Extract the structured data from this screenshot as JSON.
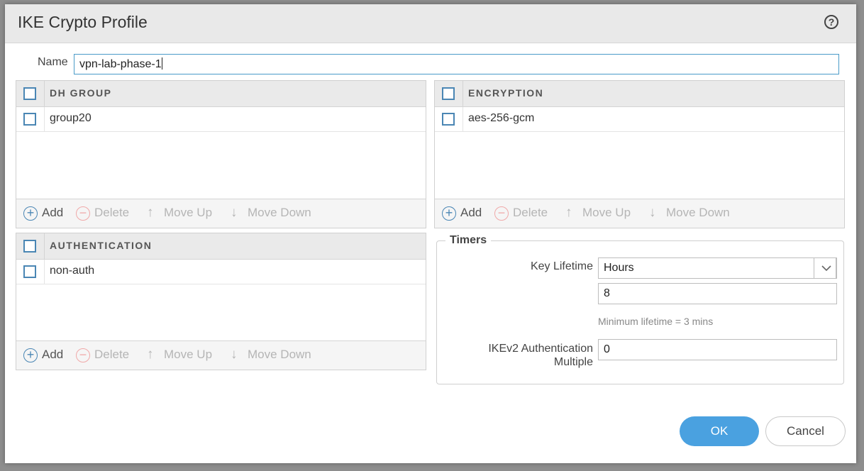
{
  "dialog": {
    "title": "IKE Crypto Profile",
    "help_icon": "help-icon"
  },
  "name": {
    "label": "Name",
    "value": "vpn-lab-phase-1"
  },
  "toolbar": {
    "add": "Add",
    "delete": "Delete",
    "move_up": "Move Up",
    "move_down": "Move Down"
  },
  "dh_group": {
    "header": "DH GROUP",
    "rows": [
      "group20"
    ]
  },
  "encryption": {
    "header": "ENCRYPTION",
    "rows": [
      "aes-256-gcm"
    ]
  },
  "authentication": {
    "header": "AUTHENTICATION",
    "rows": [
      "non-auth"
    ]
  },
  "timers": {
    "legend": "Timers",
    "key_lifetime_label": "Key Lifetime",
    "key_lifetime_unit": "Hours",
    "key_lifetime_value": "8",
    "hint": "Minimum lifetime = 3 mins",
    "ikev2_label_line1": "IKEv2 Authentication",
    "ikev2_label_line2": "Multiple",
    "ikev2_value": "0"
  },
  "buttons": {
    "ok": "OK",
    "cancel": "Cancel"
  },
  "colors": {
    "accent": "#4aa1e0",
    "checkbox_border": "#4a86b4",
    "input_focus_border": "#4a9bc8"
  }
}
